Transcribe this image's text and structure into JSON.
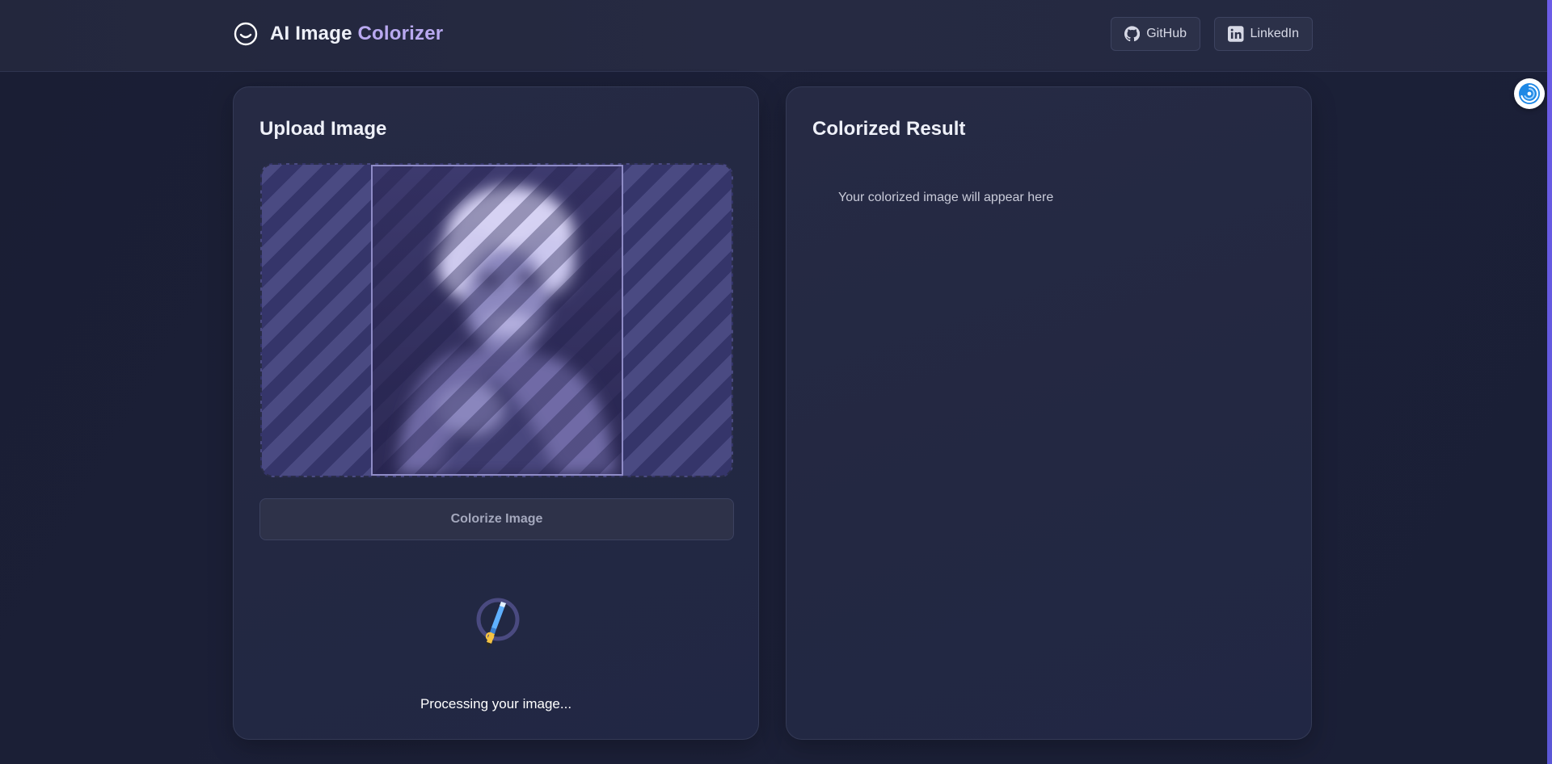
{
  "header": {
    "title_main": "AI Image ",
    "title_accent": "Colorizer",
    "logo_icon": "smile-circle-icon",
    "links": [
      {
        "label": "GitHub",
        "icon": "github-icon"
      },
      {
        "label": "LinkedIn",
        "icon": "linkedin-icon"
      }
    ]
  },
  "upload_panel": {
    "title": "Upload Image",
    "button_label": "Colorize Image",
    "status_text": "Processing your image...",
    "loader_icon": "paintbrush-icon"
  },
  "result_panel": {
    "title": "Colorized Result",
    "placeholder": "Your colorized image will appear here"
  },
  "floating_button": {
    "icon": "swirl-logo-icon"
  },
  "colors": {
    "accent": "#b9a9f0",
    "background": "#1a1e34",
    "panel": "#242944",
    "scrollbar": "#6c5ce7"
  }
}
